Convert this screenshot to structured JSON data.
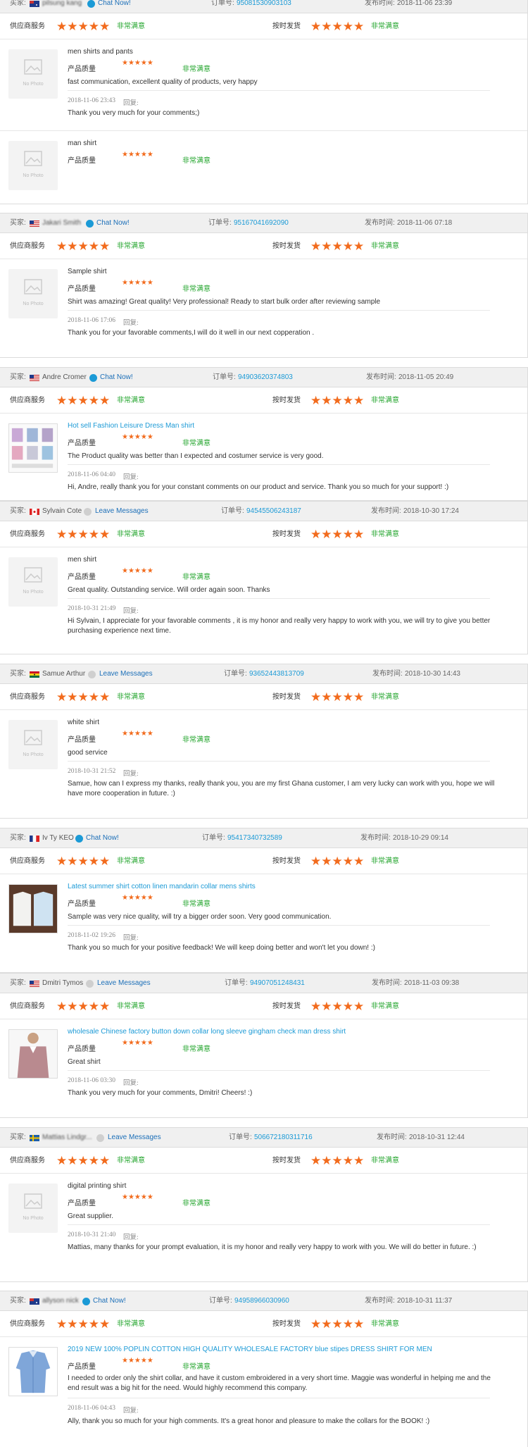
{
  "labels": {
    "buyer": "买家:",
    "order": "订单号:",
    "posted": "发布时间:",
    "supplier_service": "供应商服务",
    "on_time": "按时发货",
    "product_quality": "产品质量",
    "very_satisfied": "非常满意",
    "reply": "回复:",
    "no_photo": "No Photo",
    "stars": "★★★★★"
  },
  "colors": {
    "star": "#f26b1d",
    "satisfied": "#21a42b",
    "link": "#1c6fb8",
    "order": "#1b9ad6",
    "header_bg": "#f0f0f0"
  },
  "reviews": [
    {
      "buyer": "pilsung kang",
      "flag": "AU",
      "contact": "Chat Now!",
      "order_no": "95081530903103",
      "posted": "2018-11-06 23:39",
      "products": [
        {
          "title": "men shirts and pants",
          "comment": "fast communication, excellent quality of products, very happy",
          "reply_date": "2018-11-06 23:43",
          "reply": "Thank you very much for your comments;)",
          "image": "no-photo"
        },
        {
          "title": "man shirt",
          "image": "no-photo"
        }
      ]
    },
    {
      "buyer": "Jakari Smith",
      "flag": "US",
      "contact": "Chat Now!",
      "order_no": "95167041692090",
      "posted": "2018-11-06 07:18",
      "products": [
        {
          "title": "Sample shirt",
          "comment": "Shirt was amazing! Great quality! Very professional! Ready to start bulk order after reviewing sample",
          "reply_date": "2018-11-06 17:06",
          "reply": "Thank you for your favorable comments,I will do it well in our next copperation .",
          "image": "no-photo"
        }
      ]
    },
    {
      "buyer": "Andre Cromer",
      "flag": "US",
      "contact": "Chat Now!",
      "order_no": "94903620374803",
      "posted": "2018-11-05 20:49",
      "products": [
        {
          "title": "Hot sell Fashion Leisure Dress Man shirt",
          "comment": "The Product quality was better than I expected and costumer service is very good.",
          "reply_date": "2018-11-06 04:40",
          "reply": "Hi, Andre, really thank you for your constant comments on our product and service. Thank you so much for your support! :)",
          "image": "shirt-grid"
        }
      ]
    },
    {
      "buyer": "Sylvain Cote",
      "flag": "CA",
      "contact": "Leave Messages",
      "order_no": "94545506243187",
      "posted": "2018-10-30 17:24",
      "products": [
        {
          "title": "men shirt",
          "comment": "Great quality. Outstanding service. Will order again soon. Thanks",
          "reply_date": "2018-10-31 21:49",
          "reply": "Hi Sylvain, I appreciate for your favorable comments , it is my honor and really very happy to work with you, we will try to give you better purchasing experience next time.",
          "image": "no-photo"
        }
      ]
    },
    {
      "buyer": "Samue Arthur",
      "flag": "GH",
      "contact": "Leave Messages",
      "order_no": "93652443813709",
      "posted": "2018-10-30 14:43",
      "products": [
        {
          "title": "white shirt",
          "comment": "good service",
          "reply_date": "2018-10-31 21:52",
          "reply": "Samue, how can I express my thanks, really thank you, you are my first Ghana customer, I am very lucky can work with you, hope we will have more cooperation in future. :)",
          "image": "no-photo"
        }
      ]
    },
    {
      "buyer": "Iv Ty KEO",
      "flag": "FR",
      "contact": "Chat Now!",
      "order_no": "95417340732589",
      "posted": "2018-10-29 09:14",
      "products": [
        {
          "title": "Latest summer shirt cotton linen mandarin collar mens shirts",
          "comment": "Sample was very nice quality, will try a bigger order soon. Very good communication.",
          "reply_date": "2018-11-02 19:26",
          "reply": "Thank you so much for your positive feedback! We will keep doing better and won't let you down! :)",
          "image": "shirt-pair"
        }
      ]
    },
    {
      "buyer": "Dmitri Tymos",
      "flag": "US",
      "contact": "Leave Messages",
      "order_no": "94907051248431",
      "posted": "2018-11-03 09:38",
      "products": [
        {
          "title": "wholesale Chinese factory button down collar long sleeve gingham check man dress shirt",
          "comment": "Great shirt",
          "reply_date": "2018-11-06 03:30",
          "reply": "Thank you very much for your comments, Dmitri! Cheers! :)",
          "image": "man-model"
        }
      ]
    },
    {
      "buyer": "Mattias Lindgr...",
      "flag": "SE",
      "contact": "Leave Messages",
      "order_no": "50667218031171​6",
      "posted": "2018-10-31 12:44",
      "products": [
        {
          "title": "digital printing shirt",
          "comment": "Great supplier.",
          "reply_date": "2018-10-31 21:40",
          "reply": "Mattias, many thanks for your prompt evaluation, it is my honor and really very happy to work with you. We will do better in future. :)",
          "image": "no-photo"
        }
      ]
    },
    {
      "buyer": "allyson nick",
      "flag": "AU",
      "contact": "Chat Now!",
      "order_no": "94958966030960",
      "posted": "2018-10-31 11:37",
      "products": [
        {
          "title": "2019 NEW 100% POPLIN COTTON HIGH QUALITY WHOLESALE FACTORY blue stipes DRESS SHIRT FOR MEN",
          "comment": "I needed to order only the shirt collar, and have it custom embroidered in a very short time. Maggie was wonderful in helping me and the end result was a big hit for the need. Would highly recommend this company.",
          "reply_date": "2018-11-06 04:43",
          "reply": "Ally, thank you so much for your high comments. It's a great honor and pleasure to make the collars for the BOOK! :)",
          "image": "blue-shirt"
        }
      ]
    }
  ]
}
